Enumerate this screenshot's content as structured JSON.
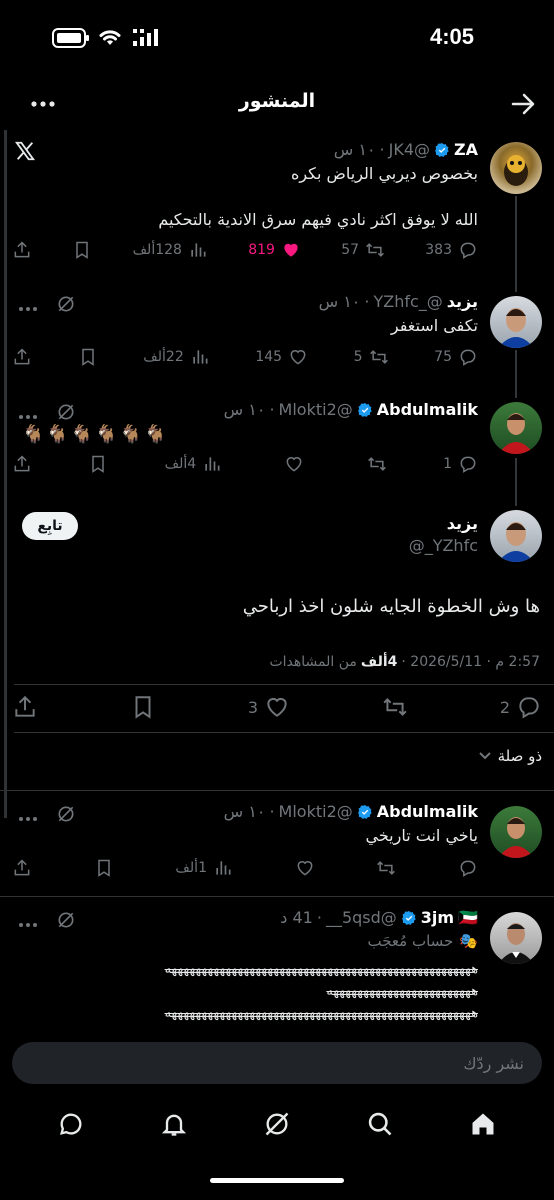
{
  "status_bar": {
    "time": "4:05"
  },
  "header": {
    "title": "المنشور"
  },
  "tweets": [
    {
      "name": "ZA",
      "handle": "@JK4",
      "time": "١٠ س",
      "lines": [
        "بخصوص ديربي الرياض بكره",
        "الله لا يوفق اكثر نادي فيهم سرق الاندية بالتحكيم"
      ],
      "replies": "383",
      "retweets": "57",
      "likes": "819",
      "views": "128ألف"
    },
    {
      "name": "يزيد",
      "handle": "@_YZhfc",
      "time": "١٠ س",
      "lines": [
        "تكفى استغفر"
      ],
      "replies": "75",
      "retweets": "5",
      "likes": "145",
      "views": "22ألف"
    },
    {
      "name": "Abdulmalik",
      "handle": "@Mlokti2",
      "time": "١٠ س",
      "lines": [
        "🐐🐐🐐🐐🐐🐐"
      ],
      "replies": "1",
      "retweets": "",
      "likes": "",
      "views": "4ألف"
    }
  ],
  "main_post": {
    "name": "يزيد",
    "handle": "@_YZhfc",
    "follow_label": "تابِع",
    "text": "ها وش الخطوة الجايه شلون اخذ ارباحي",
    "meta_date": "2:57 م · 2026/5/11 ·",
    "meta_views_count": "4ألف",
    "meta_views_label": "من المشاهدات",
    "replies": "2",
    "likes": "3",
    "related_label": "ذو صلة"
  },
  "replies_below": [
    {
      "name": "Abdulmalik",
      "handle": "@Mlokti2",
      "time": "١٠ س",
      "text": "ياخي انت تاريخي",
      "views": "1ألف"
    },
    {
      "name": "3jm",
      "flag": "🇰🇼",
      "handle": "@5qsd__",
      "time": "41 د",
      "subtitle": "حساب مُعجَب",
      "line1": "هههههههههههههههههههههههههههههههههههههههههههههههههههه",
      "line2": "ههههههههههههههههههههههههه",
      "line3": "هههههههههههههههههههههههههههههههههههههههههههههههههههه"
    }
  ],
  "compose": {
    "placeholder": "نشر ردّك"
  },
  "colors": {
    "like_pink": "#f91880",
    "verified_blue": "#1d9bf0",
    "muted": "#71767b"
  }
}
